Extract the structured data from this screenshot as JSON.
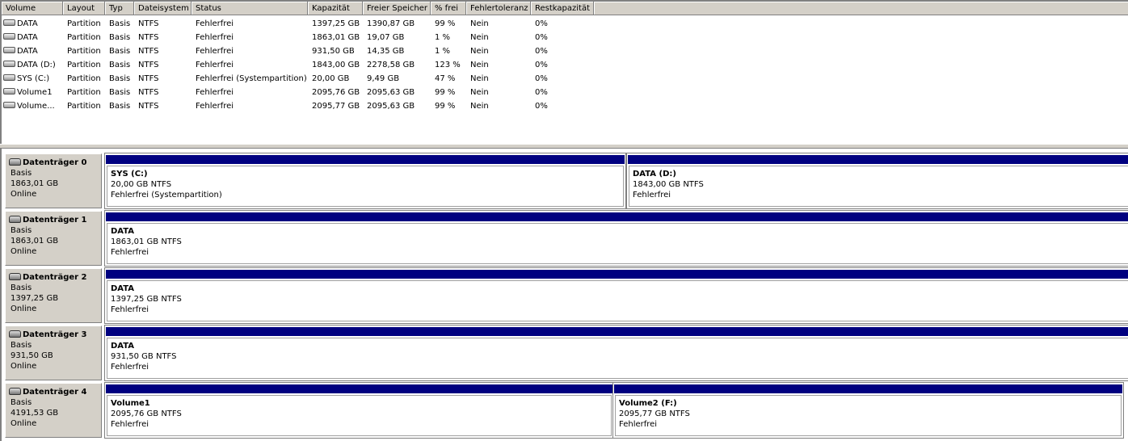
{
  "columns": [
    "Volume",
    "Layout",
    "Typ",
    "Dateisystem",
    "Status",
    "Kapazität",
    "Freier Speicher",
    "% frei",
    "Fehlertoleranz",
    "Restkapazität"
  ],
  "volumes": [
    [
      "DATA",
      "Partition",
      "Basis",
      "NTFS",
      "Fehlerfrei",
      "1397,25 GB",
      "1390,87 GB",
      "99 %",
      "Nein",
      "0%"
    ],
    [
      "DATA",
      "Partition",
      "Basis",
      "NTFS",
      "Fehlerfrei",
      "1863,01 GB",
      "19,07 GB",
      "1 %",
      "Nein",
      "0%"
    ],
    [
      "DATA",
      "Partition",
      "Basis",
      "NTFS",
      "Fehlerfrei",
      "931,50 GB",
      "14,35 GB",
      "1 %",
      "Nein",
      "0%"
    ],
    [
      "DATA (D:)",
      "Partition",
      "Basis",
      "NTFS",
      "Fehlerfrei",
      "1843,00 GB",
      "2278,58 GB",
      "123 %",
      "Nein",
      "0%"
    ],
    [
      "SYS (C:)",
      "Partition",
      "Basis",
      "NTFS",
      "Fehlerfrei (Systempartition)",
      "20,00 GB",
      "9,49 GB",
      "47 %",
      "Nein",
      "0%"
    ],
    [
      "Volume1",
      "Partition",
      "Basis",
      "NTFS",
      "Fehlerfrei",
      "2095,76 GB",
      "2095,63 GB",
      "99 %",
      "Nein",
      "0%"
    ],
    [
      "Volume...",
      "Partition",
      "Basis",
      "NTFS",
      "Fehlerfrei",
      "2095,77 GB",
      "2095,63 GB",
      "99 %",
      "Nein",
      "0%"
    ]
  ],
  "disks": [
    {
      "name": "Datenträger 0",
      "type": "Basis",
      "size": "1863,01 GB",
      "state": "Online",
      "partitions": [
        {
          "name": "SYS  (C:)",
          "size": "20,00 GB NTFS",
          "status": "Fehlerfrei (Systempartition)"
        },
        {
          "name": "DATA  (D:)",
          "size": "1843,00 GB NTFS",
          "status": "Fehlerfrei"
        }
      ]
    },
    {
      "name": "Datenträger 1",
      "type": "Basis",
      "size": "1863,01 GB",
      "state": "Online",
      "partitions": [
        {
          "name": "DATA",
          "size": "1863,01 GB NTFS",
          "status": "Fehlerfrei"
        }
      ]
    },
    {
      "name": "Datenträger 2",
      "type": "Basis",
      "size": "1397,25 GB",
      "state": "Online",
      "partitions": [
        {
          "name": "DATA",
          "size": "1397,25 GB NTFS",
          "status": "Fehlerfrei"
        }
      ]
    },
    {
      "name": "Datenträger 3",
      "type": "Basis",
      "size": "931,50 GB",
      "state": "Online",
      "partitions": [
        {
          "name": "DATA",
          "size": "931,50 GB NTFS",
          "status": "Fehlerfrei"
        }
      ]
    },
    {
      "name": "Datenträger 4",
      "type": "Basis",
      "size": "4191,53 GB",
      "state": "Online",
      "partitions": [
        {
          "name": "Volume1",
          "size": "2095,76 GB NTFS",
          "status": "Fehlerfrei"
        },
        {
          "name": "Volume2  (F:)",
          "size": "2095,77 GB NTFS",
          "status": "Fehlerfrei"
        }
      ]
    }
  ],
  "colors": {
    "partition_bar": "#000080",
    "chrome": "#d4d0c8"
  },
  "icons": {
    "volume": "hard-drive-icon",
    "disk": "disk-drive-icon"
  }
}
